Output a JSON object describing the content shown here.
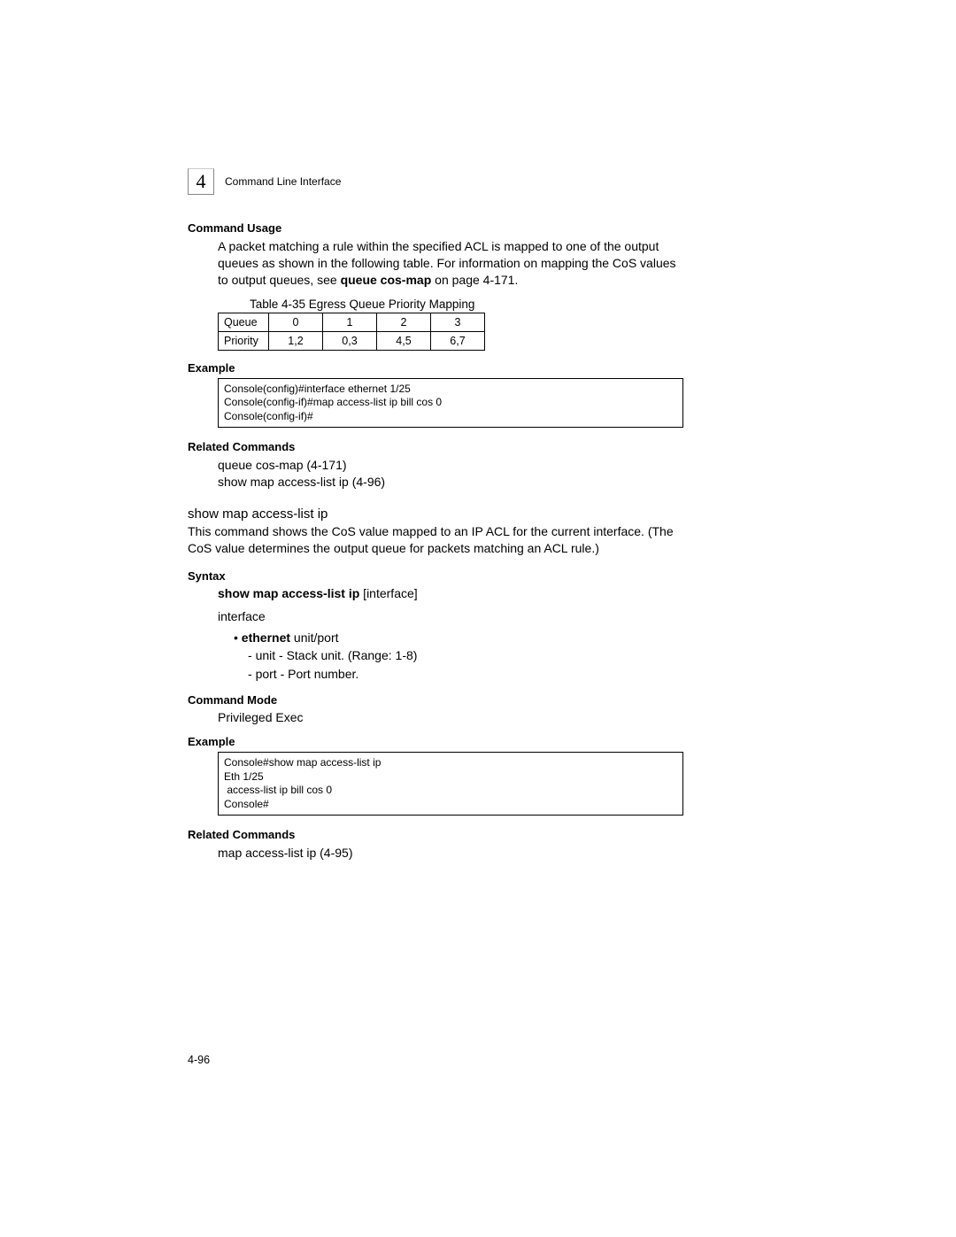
{
  "header": {
    "chapter_number": "4",
    "chapter_title": "Command Line Interface"
  },
  "command_usage": {
    "heading": "Command Usage",
    "text_pre": "A packet matching a rule within the specified ACL is mapped to one of the output queues as shown in the following table. For information on mapping the CoS values to output queues, see ",
    "text_bold": "queue cos-map",
    "text_post": " on page 4-171."
  },
  "table": {
    "caption": "Table 4-35  Egress Queue Priority Mapping",
    "rows": [
      {
        "label": "Queue",
        "c0": "0",
        "c1": "1",
        "c2": "2",
        "c3": "3"
      },
      {
        "label": "Priority",
        "c0": "1,2",
        "c1": "0,3",
        "c2": "4,5",
        "c3": "6,7"
      }
    ]
  },
  "example1": {
    "heading": "Example",
    "code": "Console(config)#interface ethernet 1/25\nConsole(config-if)#map access-list ip bill cos 0\nConsole(config-if)#"
  },
  "related1": {
    "heading": "Related Commands",
    "line1": "queue cos-map (4-171)",
    "line2": "show map access-list ip (4-96)"
  },
  "command2": {
    "title": "show map access-list ip",
    "desc": "This command shows the CoS value mapped to an IP ACL for the current interface. (The CoS value determines the output queue for packets matching an ACL rule.)"
  },
  "syntax": {
    "heading": "Syntax",
    "bold_part": "show map access-list ip",
    "rest": " [interface]",
    "interface_label": "interface",
    "ethernet_bold": "ethernet",
    "ethernet_rest": " unit/port",
    "unit_line": "unit - Stack unit. (Range: 1-8)",
    "port_line": "port - Port number."
  },
  "command_mode": {
    "heading": "Command Mode",
    "text": "Privileged Exec"
  },
  "example2": {
    "heading": "Example",
    "code": "Console#show map access-list ip\nEth 1/25\n access-list ip bill cos 0\nConsole#"
  },
  "related2": {
    "heading": "Related Commands",
    "line1": "map access-list ip (4-95)"
  },
  "page_number": "4-96"
}
